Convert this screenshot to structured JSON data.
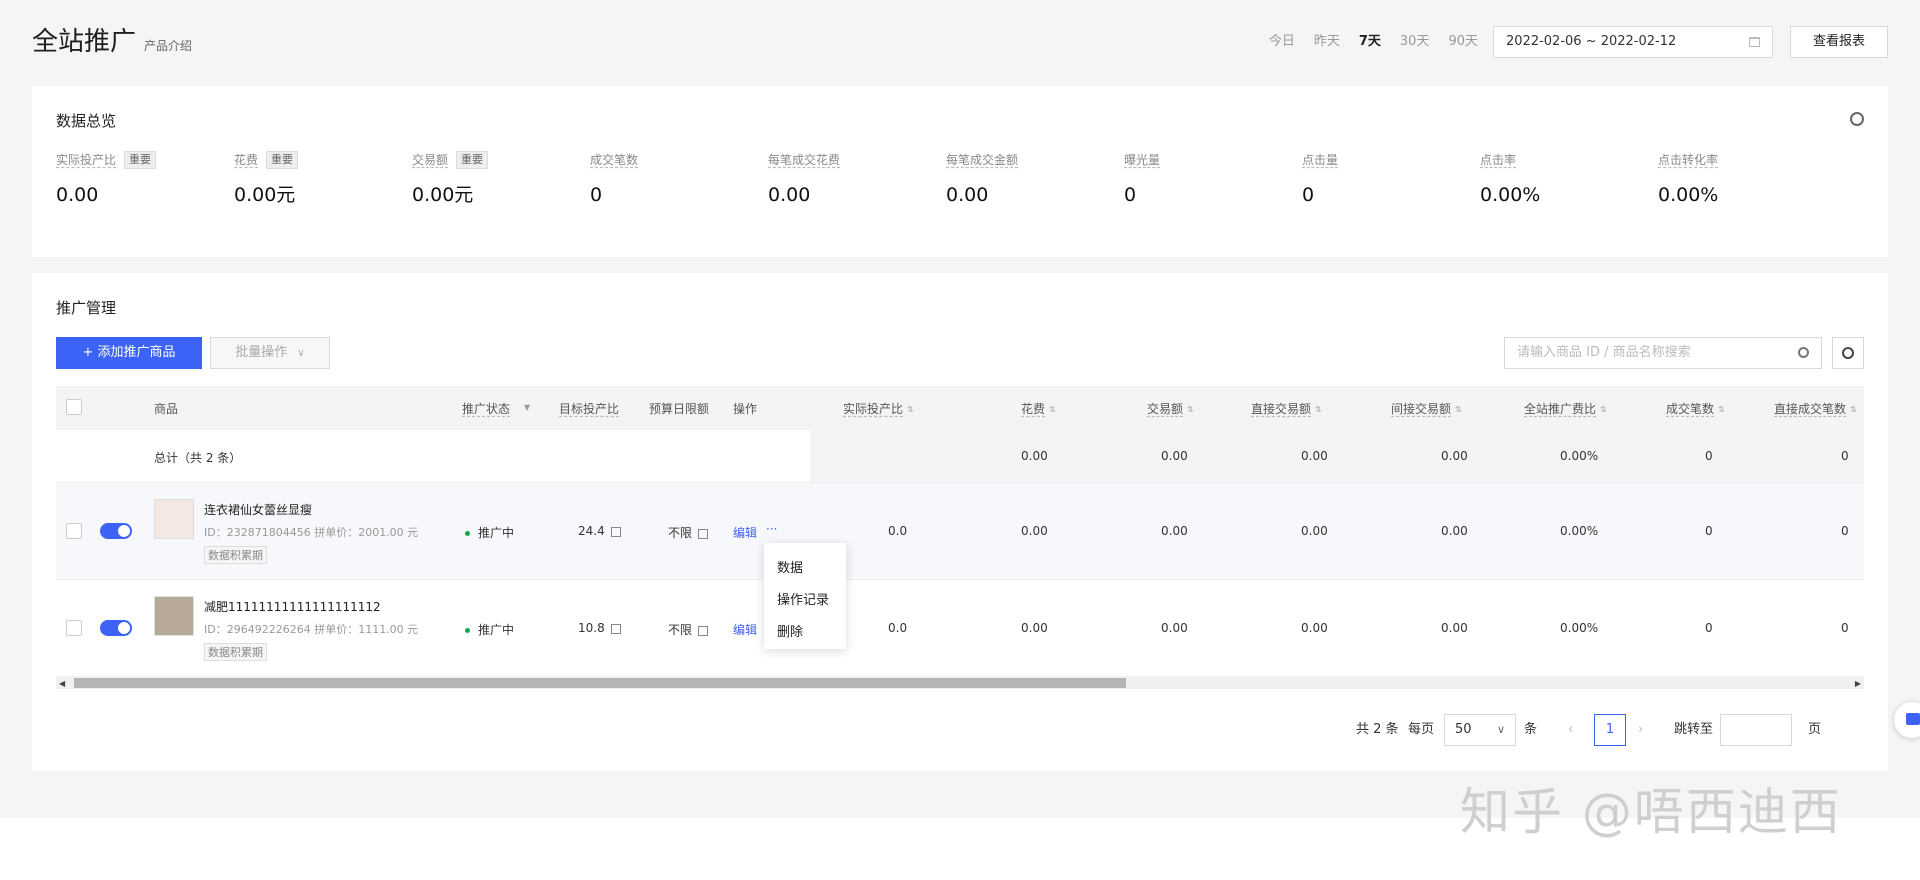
{
  "header": {
    "title": "全站推广",
    "subtitle": "产品介绍",
    "range_tabs": [
      "今日",
      "昨天",
      "7天",
      "30天",
      "90天"
    ],
    "active_range": "7天",
    "date_range": "2022-02-06 ~ 2022-02-12",
    "report_btn": "查看报表"
  },
  "overview": {
    "title": "数据总览",
    "tag": "重要",
    "metrics": [
      {
        "label": "实际投产比",
        "value": "0.00",
        "important": true
      },
      {
        "label": "花费",
        "value": "0.00元",
        "important": true
      },
      {
        "label": "交易额",
        "value": "0.00元",
        "important": true
      },
      {
        "label": "成交笔数",
        "value": "0"
      },
      {
        "label": "每笔成交花费",
        "value": "0.00"
      },
      {
        "label": "每笔成交金额",
        "value": "0.00"
      },
      {
        "label": "曝光量",
        "value": "0"
      },
      {
        "label": "点击量",
        "value": "0"
      },
      {
        "label": "点击率",
        "value": "0.00%"
      },
      {
        "label": "点击转化率",
        "value": "0.00%"
      }
    ]
  },
  "manage": {
    "title": "推广管理",
    "add_btn": "+ 添加推广商品",
    "batch_btn": "批量操作",
    "search_placeholder": "请输入商品 ID / 商品名称搜索",
    "columns": {
      "product": "商品",
      "status": "推广状态",
      "target_roi": "目标投产比",
      "budget": "预算日限额",
      "action": "操作",
      "actual_roi": "实际投产比",
      "cost": "花费",
      "gmv": "交易额",
      "direct_gmv": "直接交易额",
      "indirect_gmv": "间接交易额",
      "cost_ratio": "全站推广费比",
      "orders": "成交笔数",
      "direct_orders": "直接成交笔数"
    },
    "total": {
      "label": "总计（共 2 条）",
      "cost": "0.00",
      "gmv": "0.00",
      "direct_gmv": "0.00",
      "indirect_gmv": "0.00",
      "cost_ratio": "0.00%",
      "orders": "0",
      "direct_orders": "0"
    },
    "rows": [
      {
        "name": "连衣裙仙女蕾丝显瘦",
        "id_price": "ID：232871804456  拼单价：2001.00 元",
        "tag": "数据积累期",
        "status": "推广中",
        "target_roi": "24.4",
        "budget": "不限",
        "edit": "编辑",
        "more": "···",
        "actual_roi": "0.0",
        "cost": "0.00",
        "gmv": "0.00",
        "direct_gmv": "0.00",
        "indirect_gmv": "0.00",
        "cost_ratio": "0.00%",
        "orders": "0",
        "direct_orders": "0"
      },
      {
        "name": "减肥11111111111111111112",
        "id_price": "ID：296492226264  拼单价：1111.00 元",
        "tag": "数据积累期",
        "status": "推广中",
        "target_roi": "10.8",
        "budget": "不限",
        "edit": "编辑",
        "actual_roi": "0.0",
        "cost": "0.00",
        "gmv": "0.00",
        "direct_gmv": "0.00",
        "indirect_gmv": "0.00",
        "cost_ratio": "0.00%",
        "orders": "0",
        "direct_orders": "0"
      }
    ],
    "menu": [
      "数据",
      "操作记录",
      "删除"
    ]
  },
  "pager": {
    "total": "共 2 条",
    "per_page": "每页",
    "page_size": "50",
    "unit": "条",
    "current": "1",
    "jump": "跳转至",
    "page_unit": "页"
  },
  "watermark": "知乎 @唔西迪西",
  "colors": {
    "accent": "#3c62f6",
    "status_green": "#19a84d"
  }
}
